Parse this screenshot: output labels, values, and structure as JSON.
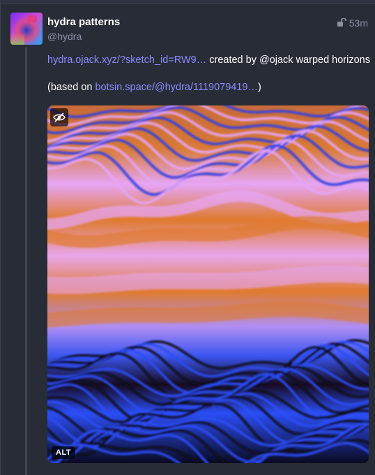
{
  "status": {
    "display_name": "hydra patterns",
    "acct": "@hydra",
    "time": "53m",
    "visibility_icon": "unlock-icon",
    "content": {
      "link1": "hydra.ojack.xyz/?sketch_id=RW9…",
      "text1": " created by @ojack warped horizons",
      "based_on_prefix": "(based on ",
      "link2": "botsin.space/@hydra/1119079419…",
      "based_on_suffix": ")"
    },
    "media": {
      "alt_label": "ALT",
      "hide_icon": "eye-slash-icon"
    }
  },
  "colors": {
    "background": "#282c37",
    "link": "#8c8dff",
    "muted": "#8b90a3",
    "pattern_orange": "#e07a2e",
    "pattern_pink": "#e6a5f5",
    "pattern_blue": "#2b4df5",
    "pattern_dark": "#120a18"
  }
}
